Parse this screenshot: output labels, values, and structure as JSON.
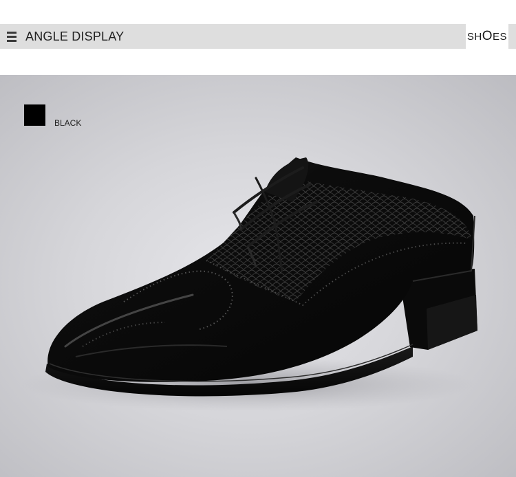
{
  "header": {
    "title": "ANGLE DISPLAY",
    "brand": {
      "prefix": "SH",
      "middle": "O",
      "suffix": "ES"
    }
  },
  "color_option": {
    "label": "BLACK",
    "color": "#000000"
  },
  "image": {
    "subject": "black-brogue-oxford-shoe",
    "background": "#d4d4d8"
  },
  "icons": {
    "menu": "menu-icon"
  }
}
